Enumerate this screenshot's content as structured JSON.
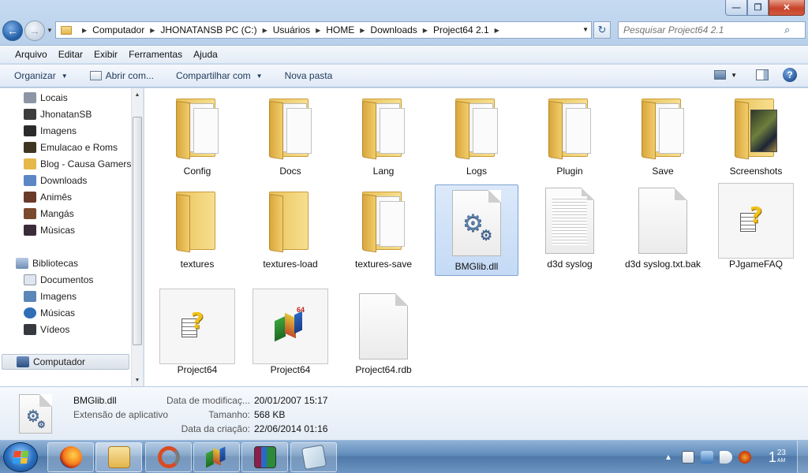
{
  "window": {
    "controls": {
      "minimize": "—",
      "maximize": "❐",
      "close": "✕"
    }
  },
  "address_bar": {
    "back": "←",
    "forward": "→",
    "breadcrumbs": [
      "Computador",
      "JHONATANSB PC (C:)",
      "Usuários",
      "HOME",
      "Downloads",
      "Project64 2.1"
    ],
    "refresh": "↻"
  },
  "search": {
    "placeholder": "Pesquisar Project64 2.1"
  },
  "menubar": {
    "items": [
      "Arquivo",
      "Editar",
      "Exibir",
      "Ferramentas",
      "Ajuda"
    ]
  },
  "toolbar": {
    "organize": "Organizar",
    "open_with": "Abrir com...",
    "share_with": "Compartilhar com",
    "new_folder": "Nova pasta",
    "help": "?"
  },
  "sidebar": {
    "favorites": [
      {
        "label": "Locais",
        "icon": "places-icon",
        "color": "#7a8595"
      },
      {
        "label": "JhonatanSB",
        "icon": "user-image-icon",
        "color": "#3c3c3c"
      },
      {
        "label": "Imagens",
        "icon": "image-thumb-icon",
        "color": "#2b2b2b"
      },
      {
        "label": "Emulacao e Roms",
        "icon": "image-thumb-icon",
        "color": "#3d3520"
      },
      {
        "label": "Blog - Causa Gamers",
        "icon": "folder-icon",
        "color": "#e5b84b"
      },
      {
        "label": "Downloads",
        "icon": "downloads-icon",
        "color": "#5c86c4"
      },
      {
        "label": "Animês",
        "icon": "image-thumb-icon",
        "color": "#6a3a2a"
      },
      {
        "label": "Mangás",
        "icon": "image-thumb-icon",
        "color": "#7a4a2e"
      },
      {
        "label": "Mùsicas",
        "icon": "image-thumb-icon",
        "color": "#3b2c3a"
      }
    ],
    "libraries_label": "Bibliotecas",
    "libraries": [
      {
        "label": "Documentos",
        "icon": "documents-icon",
        "color": "#dfe6ee"
      },
      {
        "label": "Imagens",
        "icon": "pictures-icon",
        "color": "#5a86b8"
      },
      {
        "label": "Músicas",
        "icon": "music-icon",
        "color": "#2f6fb6"
      },
      {
        "label": "Vídeos",
        "icon": "videos-icon",
        "color": "#36393e"
      }
    ],
    "computer_label": "Computador"
  },
  "files": [
    {
      "name": "Config",
      "kind": "folder"
    },
    {
      "name": "Docs",
      "kind": "folder"
    },
    {
      "name": "Lang",
      "kind": "folder"
    },
    {
      "name": "Logs",
      "kind": "folder"
    },
    {
      "name": "Plugin",
      "kind": "folder"
    },
    {
      "name": "Save",
      "kind": "folder"
    },
    {
      "name": "Screenshots",
      "kind": "folder-image"
    },
    {
      "name": "textures",
      "kind": "folder-empty"
    },
    {
      "name": "textures-load",
      "kind": "folder-empty"
    },
    {
      "name": "textures-save",
      "kind": "folder"
    },
    {
      "name": "BMGlib.dll",
      "kind": "dll",
      "selected": true
    },
    {
      "name": "d3d syslog",
      "kind": "text"
    },
    {
      "name": "d3d syslog.txt.bak",
      "kind": "blank"
    },
    {
      "name": "PJgameFAQ",
      "kind": "help"
    },
    {
      "name": "Project64",
      "kind": "help"
    },
    {
      "name": "Project64",
      "kind": "app"
    },
    {
      "name": "Project64.rdb",
      "kind": "blank"
    }
  ],
  "details": {
    "name": "BMGlib.dll",
    "type": "Extensão de aplicativo",
    "modified_label": "Data de modificaç...",
    "modified_value": "20/01/2007 15:17",
    "size_label": "Tamanho:",
    "size_value": "568 KB",
    "created_label": "Data da criação:",
    "created_value": "22/06/2014 01:16"
  },
  "taskbar": {
    "clock_hour": "1",
    "clock_minute": "23",
    "clock_ampm": "AM",
    "tray_expand": "▲",
    "apps": [
      "firefox-icon",
      "explorer-icon",
      "recorder-icon",
      "project64-icon",
      "winrar-icon",
      "notepad-icon"
    ]
  }
}
